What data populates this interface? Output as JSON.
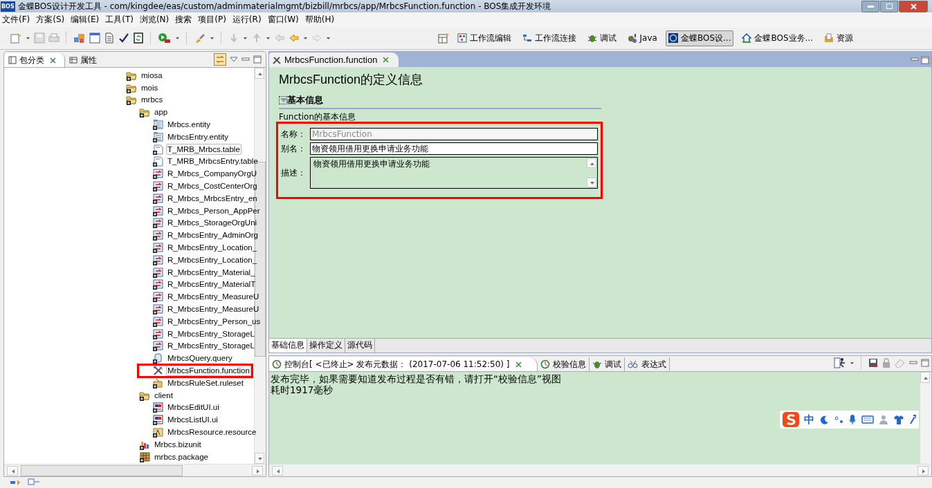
{
  "window": {
    "title": "金蝶BOS设计开发工具  -  com/kingdee/eas/custom/adminmaterialmgmt/bizbill/mrbcs/app/MrbcsFunction.function  -  BOS集成开发环境",
    "app_badge": "BOS"
  },
  "menu": [
    "文件(F)",
    "方案(S)",
    "编辑(E)",
    "工具(T)",
    "浏览(N)",
    "搜索",
    "项目(P)",
    "运行(R)",
    "窗口(W)",
    "帮助(H)"
  ],
  "perspectives": [
    {
      "label": "工作流编辑",
      "kind": "workflow",
      "selected": false
    },
    {
      "label": "工作流连接",
      "kind": "link",
      "selected": false
    },
    {
      "label": "调试",
      "kind": "bug",
      "selected": false
    },
    {
      "label": "Java",
      "kind": "java",
      "selected": false
    },
    {
      "label": "金蝶BOS设...",
      "kind": "bos",
      "selected": true
    },
    {
      "label": "金蝶BOS业务...",
      "kind": "home",
      "selected": false
    },
    {
      "label": "资源",
      "kind": "resource",
      "selected": false
    }
  ],
  "left_tabs": [
    {
      "label": "包分类",
      "selected": true,
      "closable": true
    },
    {
      "label": "属性",
      "selected": false,
      "closable": false
    }
  ],
  "tree": [
    {
      "label": "miosa",
      "kind": "folder",
      "selected": false,
      "annotated": false
    },
    {
      "label": "mois",
      "kind": "folder",
      "selected": false,
      "annotated": false
    },
    {
      "label": "mrbcs",
      "kind": "folder",
      "selected": false,
      "annotated": false,
      "children": [
        {
          "label": "app",
          "kind": "folder",
          "selected": false,
          "annotated": false,
          "children": [
            {
              "label": "Mrbcs.entity",
              "kind": "entity",
              "selected": false,
              "annotated": false
            },
            {
              "label": "MrbcsEntry.entity",
              "kind": "entity",
              "selected": false,
              "annotated": false
            },
            {
              "label": "T_MRB_Mrbcs.table",
              "kind": "table",
              "selected": true,
              "annotated": false
            },
            {
              "label": "T_MRB_MrbcsEntry.table",
              "kind": "table",
              "selected": false,
              "annotated": false
            },
            {
              "label": "R_Mrbcs_CompanyOrgU",
              "kind": "relation",
              "selected": false,
              "annotated": false
            },
            {
              "label": "R_Mrbcs_CostCenterOrg",
              "kind": "relation",
              "selected": false,
              "annotated": false
            },
            {
              "label": "R_Mrbcs_MrbcsEntry_en",
              "kind": "relation",
              "selected": false,
              "annotated": false
            },
            {
              "label": "R_Mrbcs_Person_AppPer",
              "kind": "relation",
              "selected": false,
              "annotated": false
            },
            {
              "label": "R_Mrbcs_StorageOrgUni",
              "kind": "relation",
              "selected": false,
              "annotated": false
            },
            {
              "label": "R_MrbcsEntry_AdminOrg",
              "kind": "relation",
              "selected": false,
              "annotated": false
            },
            {
              "label": "R_MrbcsEntry_Location_",
              "kind": "relation",
              "selected": false,
              "annotated": false
            },
            {
              "label": "R_MrbcsEntry_Location_",
              "kind": "relation",
              "selected": false,
              "annotated": false
            },
            {
              "label": "R_MrbcsEntry_Material_",
              "kind": "relation",
              "selected": false,
              "annotated": false
            },
            {
              "label": "R_MrbcsEntry_MaterialT",
              "kind": "relation",
              "selected": false,
              "annotated": false
            },
            {
              "label": "R_MrbcsEntry_MeasureU",
              "kind": "relation",
              "selected": false,
              "annotated": false
            },
            {
              "label": "R_MrbcsEntry_MeasureU",
              "kind": "relation",
              "selected": false,
              "annotated": false
            },
            {
              "label": "R_MrbcsEntry_Person_us",
              "kind": "relation",
              "selected": false,
              "annotated": false
            },
            {
              "label": "R_MrbcsEntry_StorageL",
              "kind": "relation",
              "selected": false,
              "annotated": false
            },
            {
              "label": "R_MrbcsEntry_StorageL",
              "kind": "relation",
              "selected": false,
              "annotated": false
            },
            {
              "label": "MrbcsQuery.query",
              "kind": "query",
              "selected": false,
              "annotated": false
            },
            {
              "label": "MrbcsFunction.function",
              "kind": "function",
              "selected": true,
              "annotated": true
            },
            {
              "label": "MrbcsRuleSet.ruleset",
              "kind": "ruleset",
              "selected": false,
              "annotated": false
            }
          ]
        },
        {
          "label": "client",
          "kind": "folder",
          "selected": false,
          "annotated": false,
          "children": [
            {
              "label": "MrbcsEditUI.ui",
              "kind": "ui",
              "selected": false,
              "annotated": false
            },
            {
              "label": "MrbcsListUI.ui",
              "kind": "ui",
              "selected": false,
              "annotated": false
            },
            {
              "label": "MrbcsResource.resource",
              "kind": "resource",
              "selected": false,
              "annotated": false
            }
          ]
        },
        {
          "label": "Mrbcs.bizunit",
          "kind": "bizunit",
          "selected": false,
          "annotated": false
        },
        {
          "label": "mrbcs.package",
          "kind": "package",
          "selected": false,
          "annotated": false
        }
      ]
    }
  ],
  "editor": {
    "tab": "MrbcsFunction.function",
    "heading": "MrbcsFunction的定义信息",
    "section": {
      "title": "基本信息",
      "expanded": true,
      "subtitle": "Function的基本信息"
    },
    "form": {
      "annotated": true,
      "fields": [
        {
          "label": "名称：",
          "value": "MrbcsFunction",
          "kind": "text",
          "disabled": true
        },
        {
          "label": "别名：",
          "value": "物资领用借用更换申请业务功能",
          "kind": "text",
          "disabled": false
        },
        {
          "label": "描述：",
          "value": "物资领用借用更换申请业务功能",
          "kind": "textarea",
          "disabled": false
        }
      ]
    },
    "bottom_tabs": [
      {
        "label": "基础信息",
        "selected": true
      },
      {
        "label": "操作定义",
        "selected": false
      },
      {
        "label": "源代码",
        "selected": false
      }
    ]
  },
  "console": {
    "tabs": [
      {
        "label": "控制台[ <已终止> 发布元数据： (2017-07-06 11:52:50) ]",
        "kind": "console",
        "selected": true,
        "closable": true
      },
      {
        "label": "校验信息",
        "kind": "check",
        "selected": false,
        "closable": false
      },
      {
        "label": "调试",
        "kind": "bug",
        "selected": false,
        "closable": false
      },
      {
        "label": "表达式",
        "kind": "expr",
        "selected": false,
        "closable": false
      }
    ],
    "lines": [
      "发布完毕，如果需要知道发布过程是否有错，请打开“校验信息”视图",
      "耗时1917毫秒"
    ]
  },
  "ime_bar": {
    "mode": "中"
  }
}
